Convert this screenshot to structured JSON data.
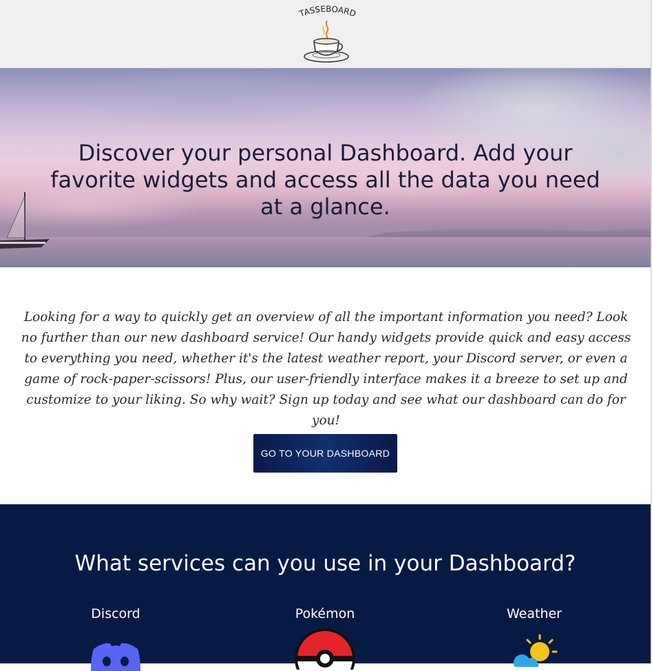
{
  "header": {
    "logo_text": "TASSEBOARD"
  },
  "hero": {
    "title": "Discover your personal Dashboard. Add your favorite widgets and access all the data you need at a glance."
  },
  "intro": {
    "text": "Looking for a way to quickly get an overview of all the important information you need? Look no further than our new dashboard service! Our handy widgets provide quick and easy access to everything you need, whether it's the latest weather report, your Discord server, or even a game of rock-paper-scissors! Plus, our user-friendly interface makes it a breeze to set up and customize to your liking. So why wait? Sign up today and see what our dashboard can do for you!"
  },
  "cta": {
    "label": "GO TO YOUR DASHBOARD"
  },
  "services": {
    "title": "What services can you use in your Dashboard?",
    "items": [
      {
        "label": "Discord",
        "icon": "discord-icon",
        "color": "#5865f2"
      },
      {
        "label": "Pokémon",
        "icon": "pokeball-icon",
        "color": "#e3242b"
      },
      {
        "label": "Weather",
        "icon": "weather-sun-cloud-icon",
        "color": "#f6c21c"
      }
    ]
  },
  "colors": {
    "header_bg": "#f0f0f0",
    "services_bg": "#071a44",
    "button_bg": "#11306e"
  }
}
